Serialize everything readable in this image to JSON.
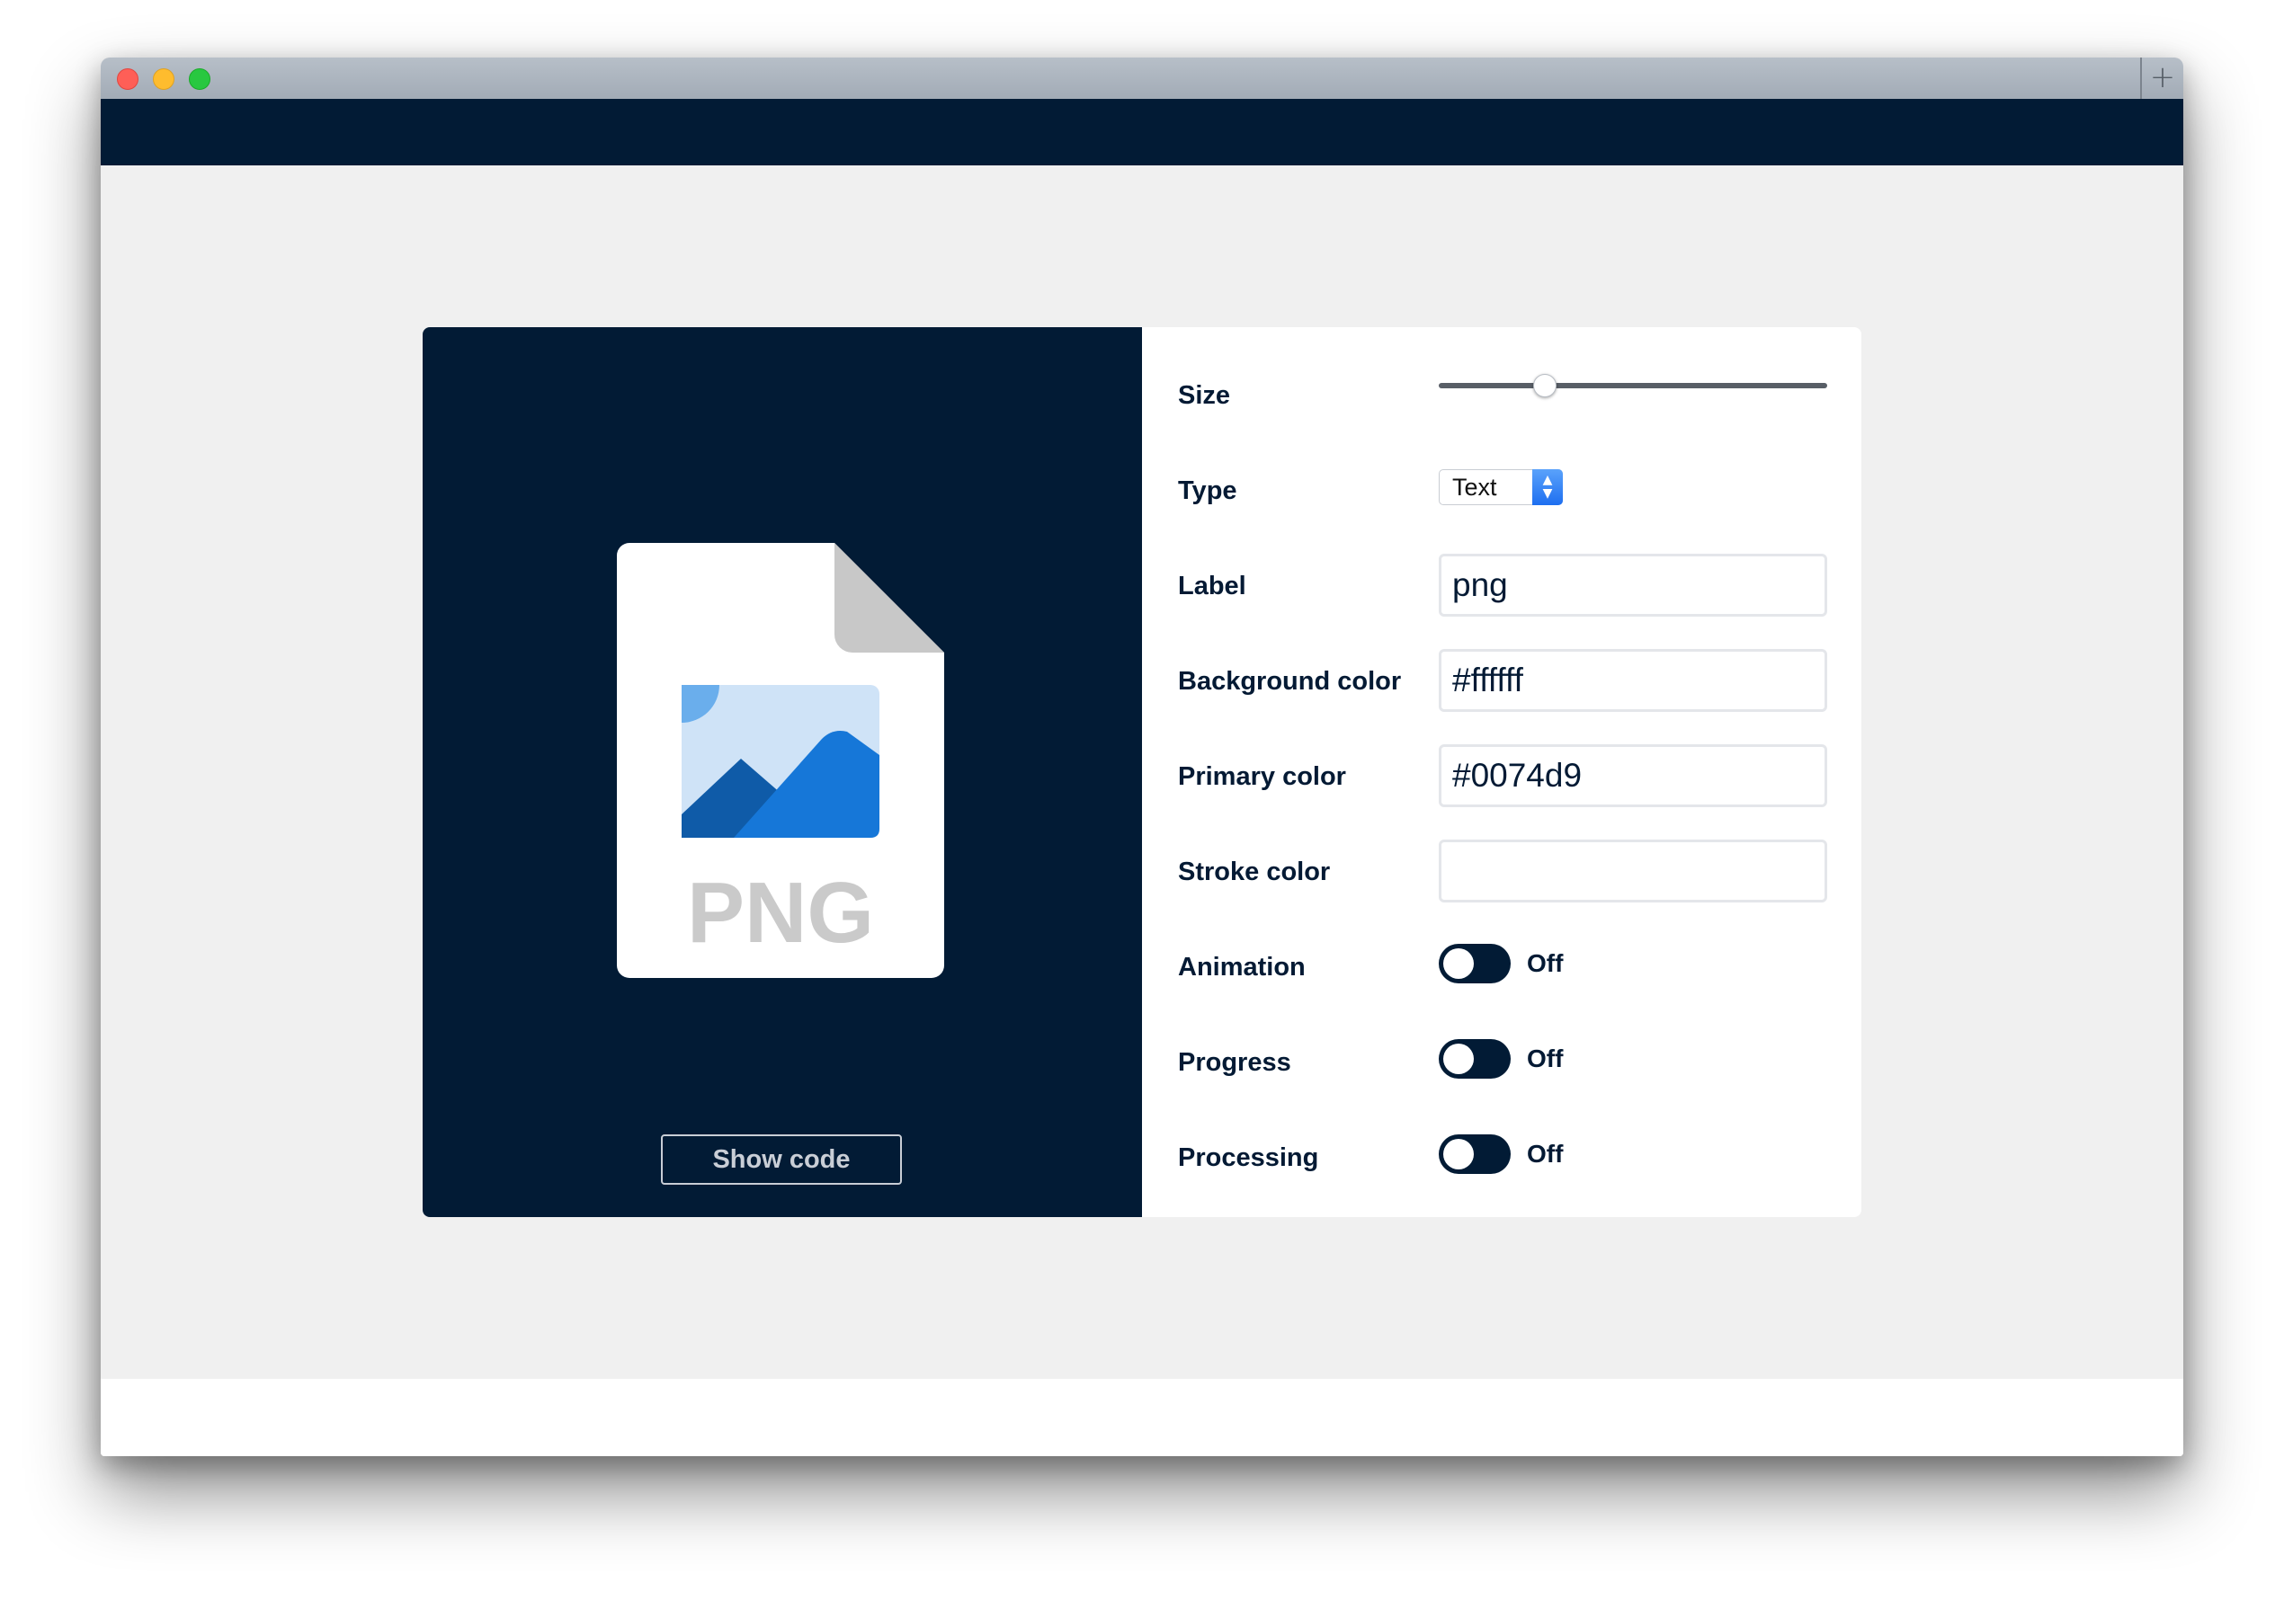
{
  "window": {
    "new_tab_symbol": "+"
  },
  "preview": {
    "file_label": "PNG",
    "show_code_label": "Show code"
  },
  "settings": {
    "size": {
      "label": "Size",
      "value_fraction": 0.27
    },
    "type": {
      "label": "Type",
      "selected": "Text"
    },
    "label": {
      "label": "Label",
      "value": "png"
    },
    "background_color": {
      "label": "Background color",
      "value": "#ffffff"
    },
    "primary_color": {
      "label": "Primary color",
      "value": "#0074d9"
    },
    "stroke_color": {
      "label": "Stroke color",
      "value": ""
    },
    "animation": {
      "label": "Animation",
      "state": "Off"
    },
    "progress": {
      "label": "Progress",
      "state": "Off"
    },
    "processing": {
      "label": "Processing",
      "state": "Off"
    }
  },
  "colors": {
    "header": "#021b35",
    "preview_bg": "#021b35",
    "icon_primary": "#0074d9"
  },
  "icons": {
    "file": "png-file-icon",
    "image": "image-mountain-icon",
    "select_arrows": "up-down-arrows-icon"
  }
}
